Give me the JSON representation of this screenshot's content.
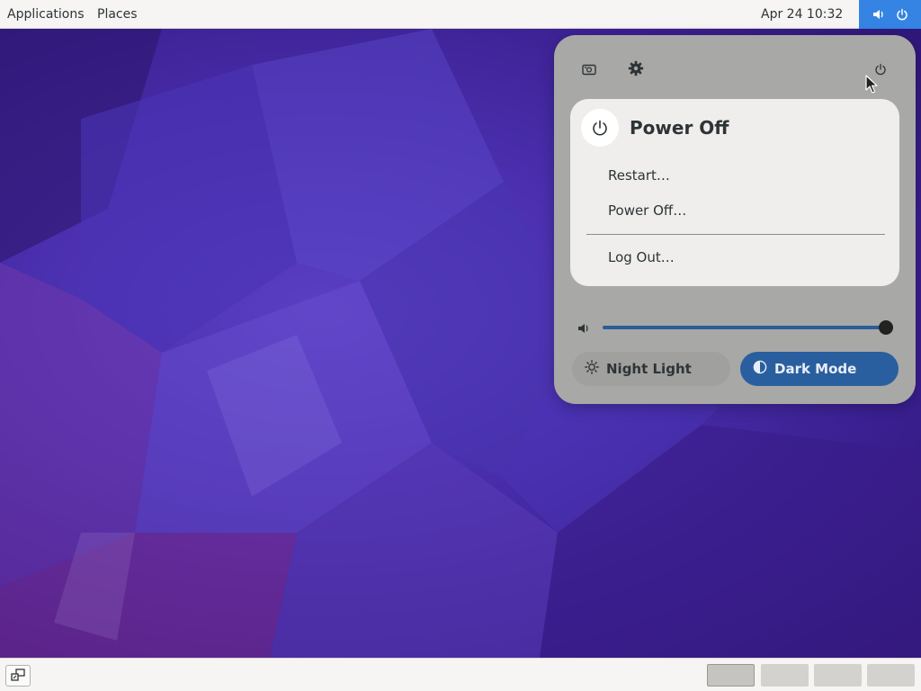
{
  "top_bar": {
    "applications_label": "Applications",
    "places_label": "Places",
    "clock": "Apr 24  10:32",
    "indicator_color": "#3584e4",
    "indicators": [
      "volume-icon",
      "power-icon"
    ]
  },
  "quick_settings": {
    "top_buttons": [
      "screenshot-icon",
      "gear-icon",
      "power-icon"
    ],
    "power_submenu": {
      "title": "Power Off",
      "items": [
        "Restart…",
        "Power Off…",
        "Log Out…"
      ]
    },
    "volume": {
      "level": 1.0
    },
    "toggles": {
      "night_light": {
        "label": "Night Light",
        "active": false
      },
      "dark_mode": {
        "label": "Dark Mode",
        "active": true,
        "accent": "#2a5f9f"
      }
    }
  },
  "bottom_bar": {
    "workspaces": {
      "count": 4,
      "active_index": 0
    }
  }
}
